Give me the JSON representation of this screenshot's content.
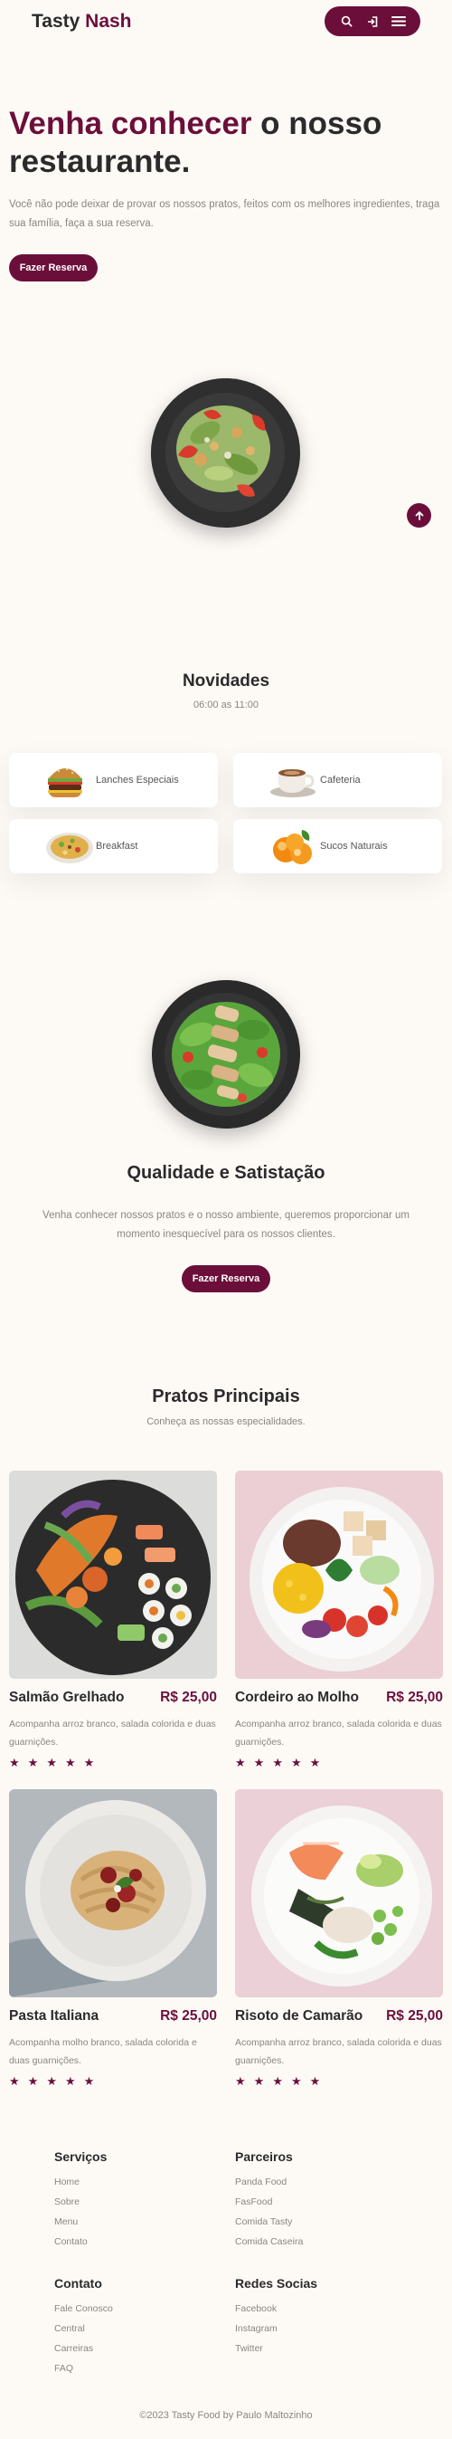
{
  "header": {
    "logo_part1": "Tasty",
    "logo_part2": "Nash",
    "icons": [
      "search-icon",
      "login-icon",
      "menu-icon"
    ]
  },
  "hero": {
    "title_accent": "Venha conhecer",
    "title_rest": " o nosso restaurante.",
    "text": "Você não pode deixar de provar os nossos pratos, feitos com os melhores ingredientes, traga sua família, faça a sua reserva.",
    "button": "Fazer Reserva"
  },
  "novidades": {
    "title": "Novidades",
    "hours": "06:00 as 11:00",
    "categories": [
      {
        "label": "Lanches Especiais",
        "icon": "burger"
      },
      {
        "label": "Cafeteria",
        "icon": "coffee"
      },
      {
        "label": "Breakfast",
        "icon": "rice-dish"
      },
      {
        "label": "Sucos Naturais",
        "icon": "oranges"
      }
    ]
  },
  "quality": {
    "title": "Qualidade e Satistação",
    "text": "Venha conhecer nossos pratos e o nosso ambiente, queremos proporcionar um momento inesquecível para os nossos clientes.",
    "button": "Fazer Reserva"
  },
  "pratos": {
    "title": "Pratos Principais",
    "subtitle": "Conheça as nossas especialidades.",
    "items": [
      {
        "name": "Salmão Grelhado",
        "price": "R$ 25,00",
        "desc": "Acompanha arroz branco, salada colorida e duas guarnições.",
        "rating": 5
      },
      {
        "name": "Cordeiro ao Molho",
        "price": "R$ 25,00",
        "desc": "Acompanha arroz branco, salada colorida e duas guarnições.",
        "rating": 5
      },
      {
        "name": "Pasta Italiana",
        "price": "R$ 25,00",
        "desc": "Acompanha molho branco, salada colorida e duas guarnições.",
        "rating": 5
      },
      {
        "name": "Risoto de Camarão",
        "price": "R$ 25,00",
        "desc": "Acompanha arroz branco, salada colorida e duas guarnições.",
        "rating": 5
      }
    ]
  },
  "footer": {
    "columns": [
      {
        "title": "Serviços",
        "links": [
          "Home",
          "Sobre",
          "Menu",
          "Contato"
        ]
      },
      {
        "title": "Parceiros",
        "links": [
          "Panda Food",
          "FasFood",
          "Comida Tasty",
          "Comida Caseira"
        ]
      },
      {
        "title": "Contato",
        "links": [
          "Fale Conosco",
          "Central",
          "Carreiras",
          "FAQ"
        ]
      },
      {
        "title": "Redes Socias",
        "links": [
          "Facebook",
          "Instagram",
          "Twitter"
        ]
      }
    ],
    "copyright": "©2023 Tasty Food by Paulo Maltozinho"
  },
  "colors": {
    "accent": "#6b0f3a",
    "background": "#fdfaf6",
    "text": "#2b2b2b",
    "muted": "#8a8580"
  }
}
